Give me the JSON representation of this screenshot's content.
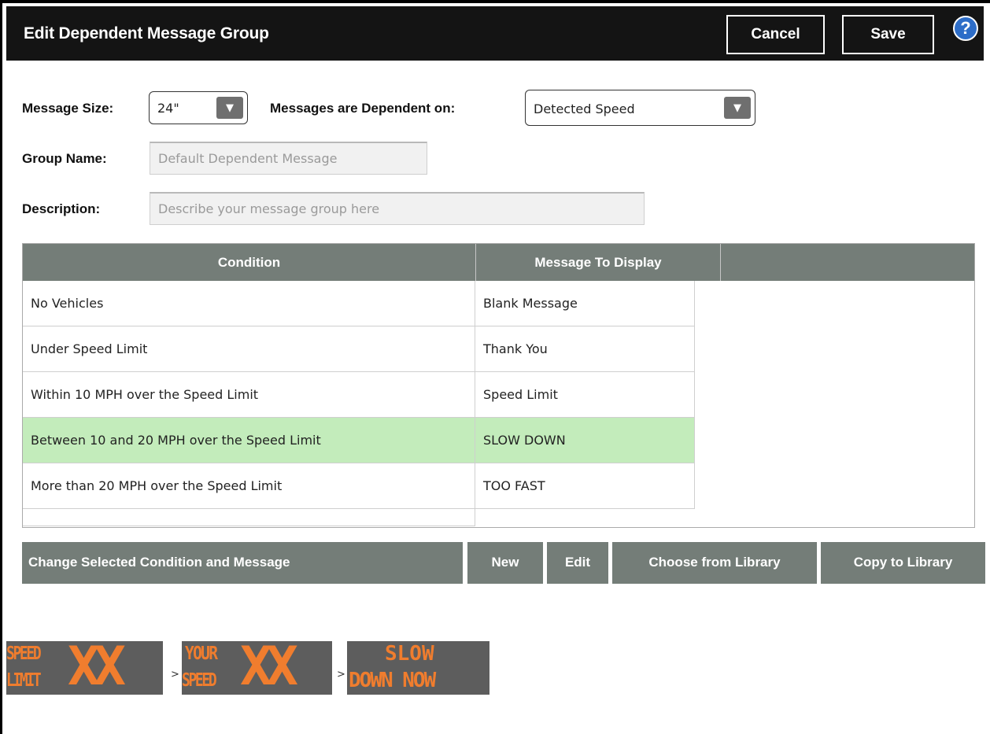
{
  "header": {
    "title": "Edit Dependent Message Group",
    "cancel_label": "Cancel",
    "save_label": "Save",
    "help_glyph": "?"
  },
  "form": {
    "message_size_label": "Message Size:",
    "message_size_value": "24\"",
    "dependent_on_label": "Messages are Dependent on:",
    "dependent_on_value": "Detected Speed",
    "group_name_label": "Group Name:",
    "group_name_placeholder": "Default Dependent Message",
    "description_label": "Description:",
    "description_placeholder": "Describe your message group here"
  },
  "table": {
    "columns": [
      "Condition",
      "Message To Display"
    ],
    "rows": [
      {
        "condition": "No Vehicles",
        "message": "Blank Message"
      },
      {
        "condition": "Under Speed Limit",
        "message": "Thank You"
      },
      {
        "condition": "Within 10 MPH over the Speed Limit",
        "message": "Speed Limit"
      },
      {
        "condition": "Between 10 and 20 MPH over the Speed Limit",
        "message": "SLOW DOWN"
      },
      {
        "condition": "More than 20 MPH over the Speed Limit",
        "message": "TOO FAST"
      }
    ],
    "selected_row": 3
  },
  "actions": {
    "title": "Change Selected Condition and Message",
    "new_label": "New",
    "edit_label": "Edit",
    "choose_label": "Choose from Library",
    "copy_label": "Copy to Library"
  },
  "preview": {
    "separator": ">",
    "frames": [
      {
        "line1": "SPEED",
        "line2": "LIMIT",
        "big": "XX"
      },
      {
        "line1": "YOUR",
        "line2": "SPEED",
        "big": "XX"
      },
      {
        "line1": "SLOW",
        "line2": "DOWN NOW"
      }
    ]
  },
  "colors": {
    "title_bar": "#141414",
    "grid_header": "#747d78",
    "selected_row": "#c3ecbb",
    "sign_bg": "#5d5d5d",
    "sign_text": "#f07d2e",
    "help": "#2d6dc8"
  }
}
